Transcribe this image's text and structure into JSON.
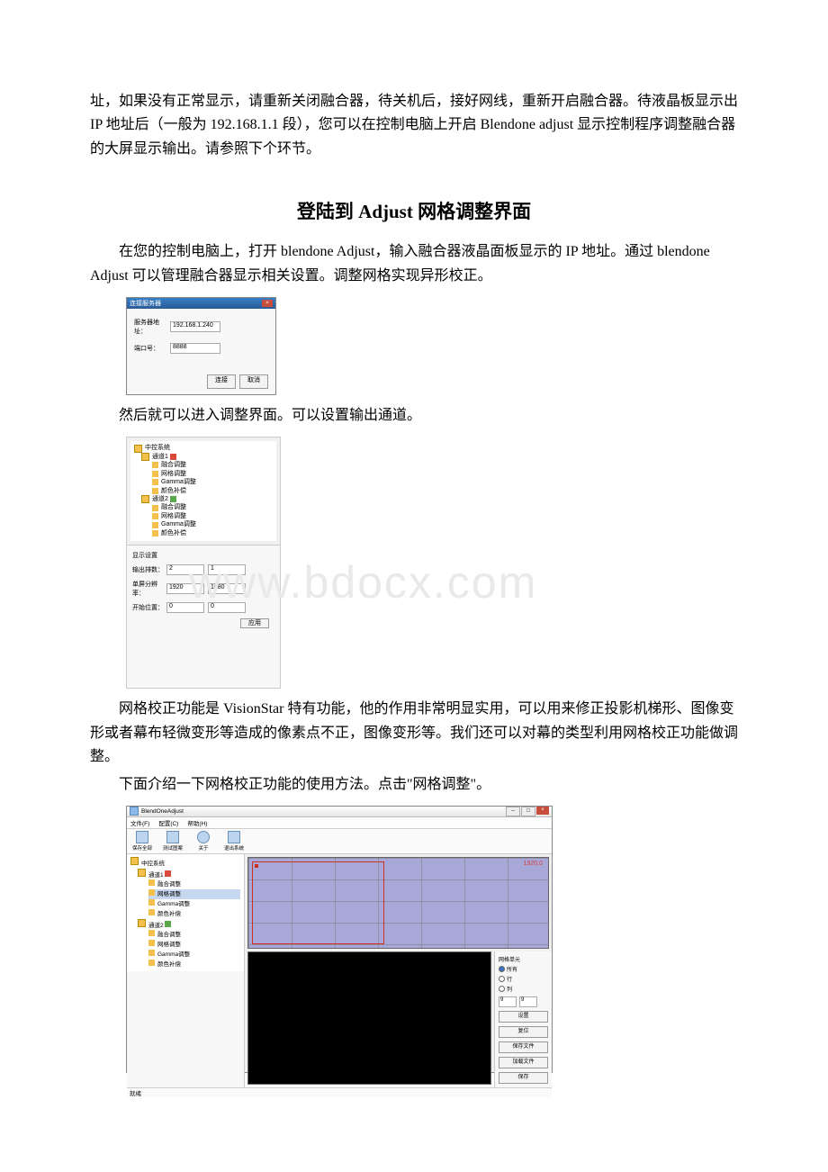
{
  "paragraphs": {
    "p0": "址，如果没有正常显示，请重新关闭融合器，待关机后，接好网线，重新开启融合器。待液晶板显示出 IP 地址后（一般为 192.168.1.1 段），您可以在控制电脑上开启 Blendone adjust 显示控制程序调整融合器的大屏显示输出。请参照下个环节。",
    "h1": "登陆到 Adjust 网格调整界面",
    "p1": "在您的控制电脑上，打开 blendone Adjust，输入融合器液晶面板显示的 IP 地址。通过 blendone Adjust 可以管理融合器显示相关设置。调整网格实现异形校正。",
    "p2": "然后就可以进入调整界面。可以设置输出通道。",
    "p3": "网格校正功能是 VisionStar 特有功能，他的作用非常明显实用，可以用来修正投影机梯形、图像变形或者幕布轻微变形等造成的像素点不正，图像变形等。我们还可以对幕的类型利用网格校正功能做调整。",
    "p4": "下面介绍一下网格校正功能的使用方法。点击\"网格调整\"。"
  },
  "watermark": "www.bdocx.com",
  "dialog1": {
    "title": "连接服务器",
    "label_addr": "服务器地址：",
    "label_port": "端口号：",
    "val_addr": "192.168.1.240",
    "val_port": "8888",
    "btn_connect": "连接",
    "btn_cancel": "取消"
  },
  "panel2": {
    "tree": {
      "root": "中控系统",
      "ch1": "通道1",
      "ch2": "通道2",
      "items": {
        "a": "融合调整",
        "b": "网格调整",
        "c": "Gamma调整",
        "d": "颜色补偿"
      }
    },
    "settings": {
      "title": "显示设置",
      "lbl_rows": "输出排数：",
      "lbl_res": "单屏分辨率：",
      "lbl_start": "开始位置：",
      "v_rows_a": "2",
      "v_rows_b": "1",
      "v_res_a": "1920",
      "v_res_b": "1080",
      "v_start_a": "0",
      "v_start_b": "0",
      "btn_apply": "应用"
    }
  },
  "app3": {
    "title": "BlendOneAdjust",
    "menu": {
      "file": "文件(F)",
      "config": "配置(C)",
      "help": "帮助(H)"
    },
    "toolbar": {
      "saveall": "保存全部",
      "testimg": "测试图案",
      "about": "关于",
      "exit": "退出系统"
    },
    "tree": {
      "root": "中控系统",
      "ch1": "通道1",
      "ch2": "通道2",
      "items": {
        "a": "融合调整",
        "b": "网格调整",
        "c": "Gamma调整",
        "d": "颜色补偿"
      }
    },
    "canvas_label": "1920,0",
    "controls": {
      "grouptitle": "网格单元",
      "rad_all": "所有",
      "rad_row": "行",
      "rad_col": "列",
      "split_a": "9",
      "split_b": "9",
      "btn_set": "设置",
      "btn_reset": "复位",
      "btn_savefile": "保存文件",
      "btn_loadfile": "加载文件",
      "btn_save": "保存"
    },
    "status": "就绪"
  }
}
